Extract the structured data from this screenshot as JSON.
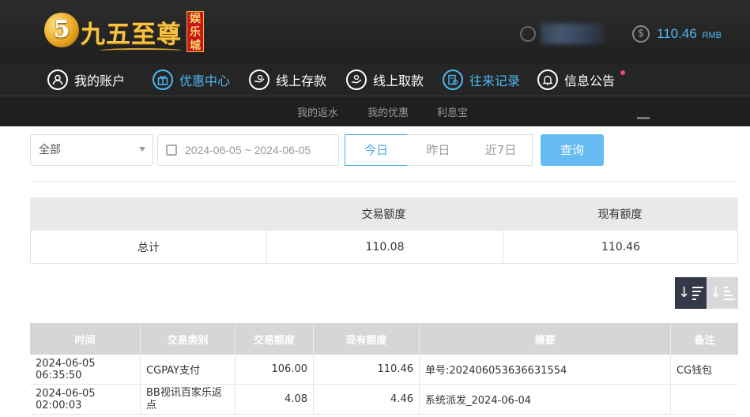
{
  "header": {
    "logo_mark": "5",
    "logo_text": "九五至尊",
    "logo_badge": "娱乐城",
    "balance_value": "110.46",
    "balance_unit": "RMB"
  },
  "nav": {
    "items": [
      {
        "label": "我的账户",
        "icon": "user-icon"
      },
      {
        "label": "优惠中心",
        "icon": "gift-icon"
      },
      {
        "label": "线上存款",
        "icon": "deposit-icon"
      },
      {
        "label": "线上取款",
        "icon": "withdraw-icon"
      },
      {
        "label": "往来记录",
        "icon": "record-icon"
      },
      {
        "label": "信息公告",
        "icon": "bell-icon"
      }
    ],
    "active_color": "#4db8f5"
  },
  "subnav": {
    "items": [
      "我的返水",
      "我的优惠",
      "利息宝"
    ]
  },
  "filters": {
    "type_select": "全部",
    "date_range": "2024-06-05 ~ 2024-06-05",
    "quick_dates": [
      "今日",
      "昨日",
      "近7日"
    ],
    "query_button": "查询"
  },
  "summary": {
    "headers": [
      "",
      "交易额度",
      "现有额度"
    ],
    "row": [
      "总计",
      "110.08",
      "110.46"
    ]
  },
  "transactions": {
    "headers": [
      "时间",
      "交易类别",
      "交易额度",
      "现有额度",
      "摘要",
      "备注"
    ],
    "rows": [
      [
        "2024-06-05 06:35:50",
        "CGPAY支付",
        "106.00",
        "110.46",
        "单号:202406053636631554",
        "CG钱包"
      ],
      [
        "2024-06-05 02:00:03",
        "BB视讯百家乐返点",
        "4.08",
        "4.46",
        "系统派发_2024-06-04",
        ""
      ]
    ]
  }
}
